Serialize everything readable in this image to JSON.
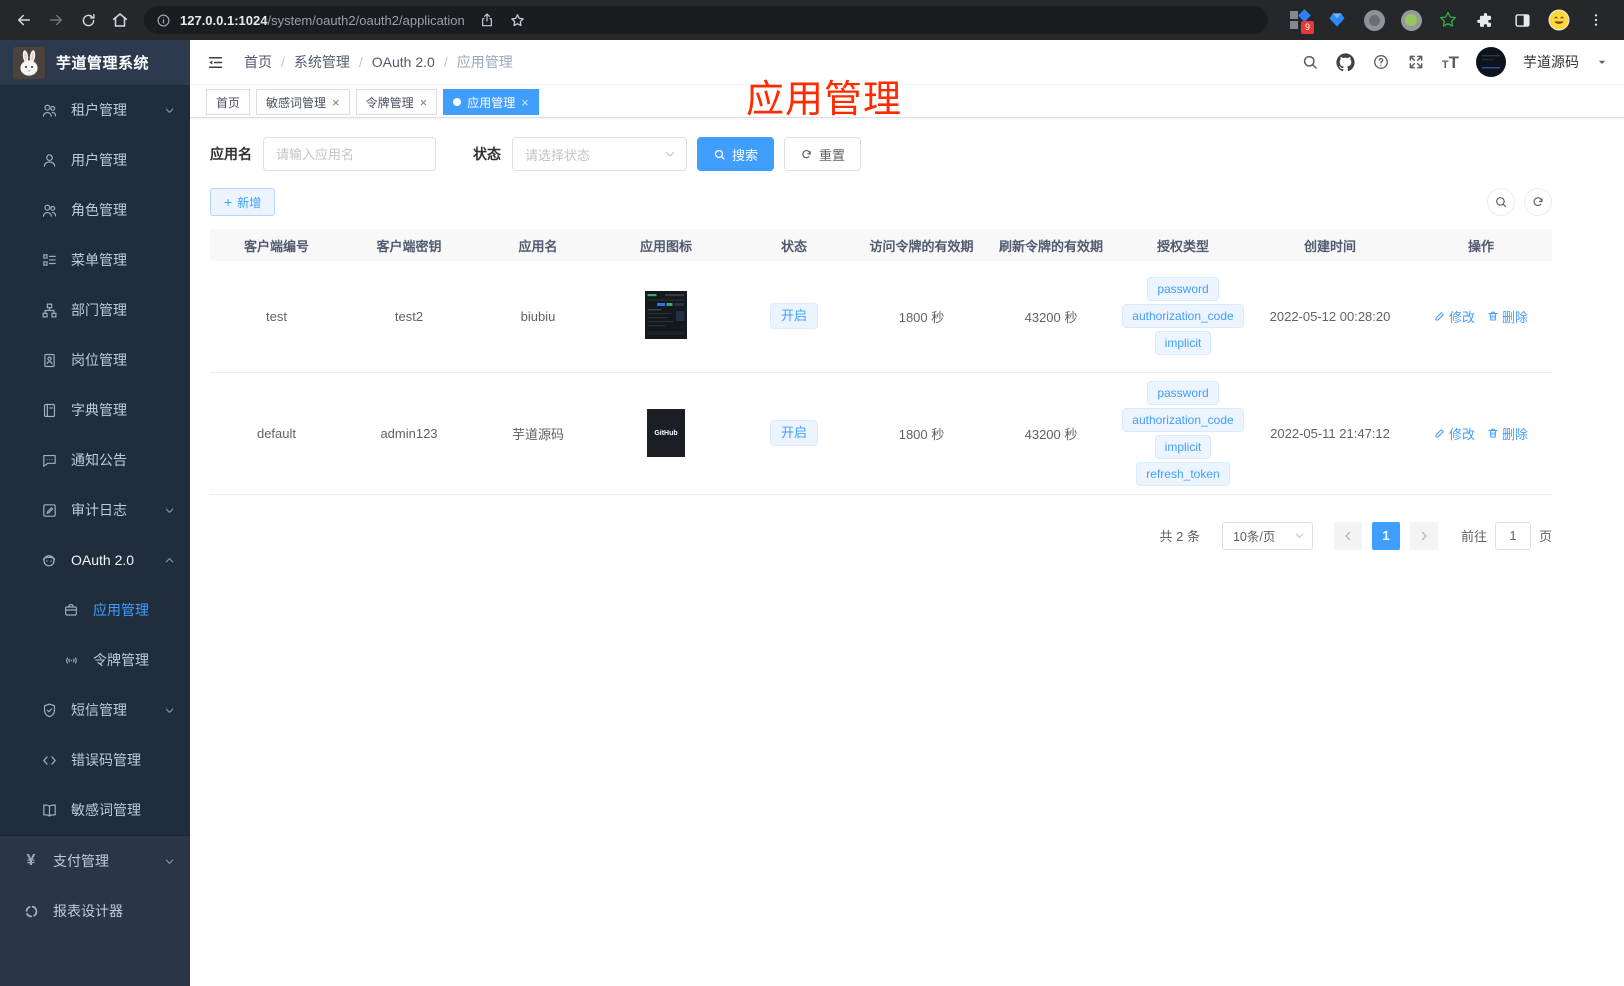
{
  "browser": {
    "host": "127.0.0.1:1024",
    "path": "/system/oauth2/oauth2/application",
    "extension_badge": "9"
  },
  "logo": {
    "title": "芋道管理系统"
  },
  "header": {
    "breadcrumb": [
      "首页",
      "系统管理",
      "OAuth 2.0",
      "应用管理"
    ],
    "sep": "/",
    "user": "芋道源码"
  },
  "tabs": [
    {
      "label": "首页"
    },
    {
      "label": "敏感词管理",
      "closable": true
    },
    {
      "label": "令牌管理",
      "closable": true
    },
    {
      "label": "应用管理",
      "closable": true,
      "active": true
    }
  ],
  "annotation": {
    "text": "应用管理",
    "color": "#ff2b00"
  },
  "sidebar": {
    "items": [
      {
        "label": "租户管理",
        "icon": "users",
        "expandable": true
      },
      {
        "label": "用户管理",
        "icon": "user"
      },
      {
        "label": "角色管理",
        "icon": "role-users"
      },
      {
        "label": "菜单管理",
        "icon": "menu-tree"
      },
      {
        "label": "部门管理",
        "icon": "org-chart"
      },
      {
        "label": "岗位管理",
        "icon": "id-badge"
      },
      {
        "label": "字典管理",
        "icon": "dictionary"
      },
      {
        "label": "通知公告",
        "icon": "announcement"
      },
      {
        "label": "审计日志",
        "icon": "audit-log",
        "expandable": true
      },
      {
        "label": "OAuth 2.0",
        "icon": "robot",
        "expandable": true,
        "expanded": true
      },
      {
        "label": "应用管理",
        "icon": "briefcase",
        "child": true,
        "active": true
      },
      {
        "label": "令牌管理",
        "icon": "token-signal",
        "child": true
      },
      {
        "label": "短信管理",
        "icon": "shield-check",
        "expandable": true
      },
      {
        "label": "错误码管理",
        "icon": "code"
      },
      {
        "label": "敏感词管理",
        "icon": "open-book"
      }
    ],
    "bottom_items": [
      {
        "label": "支付管理",
        "icon": "yen",
        "expandable": true
      },
      {
        "label": "报表设计器",
        "icon": "report-circle"
      }
    ]
  },
  "filters": {
    "name_label": "应用名",
    "name_placeholder": "请输入应用名",
    "status_label": "状态",
    "status_placeholder": "请选择状态",
    "search_label": "搜索",
    "reset_label": "重置"
  },
  "toolbar": {
    "add_label": "新增"
  },
  "icons": {
    "plus": "+",
    "close": "×",
    "yen": "¥",
    "code_glyph": "</>"
  },
  "table": {
    "columns": [
      "客户端编号",
      "客户端密钥",
      "应用名",
      "应用图标",
      "状态",
      "访问令牌的有效期",
      "刷新令牌的有效期",
      "授权类型",
      "创建时间",
      "操作"
    ],
    "edit_label": "修改",
    "delete_label": "删除",
    "rows": [
      {
        "client_id": "test",
        "secret": "test2",
        "name": "biubiu",
        "icon": "dashboard-screenshot-thumbnail",
        "status": "开启",
        "access_ttl": "1800 秒",
        "refresh_ttl": "43200 秒",
        "grants": [
          "password",
          "authorization_code",
          "implicit"
        ],
        "created": "2022-05-12 00:28:20"
      },
      {
        "client_id": "default",
        "secret": "admin123",
        "name": "芋道源码",
        "icon": "github-dark-logo",
        "icon_text": "GitHub",
        "status": "开启",
        "access_ttl": "1800 秒",
        "refresh_ttl": "43200 秒",
        "grants": [
          "password",
          "authorization_code",
          "implicit",
          "refresh_token"
        ],
        "created": "2022-05-11 21:47:12"
      }
    ]
  },
  "pagination": {
    "total": "共 2 条",
    "page_size": "10条/页",
    "current": "1",
    "goto_label": "前往",
    "goto_value": "1",
    "unit": "页"
  },
  "colors": {
    "accent": "#409eff",
    "tag_bg": "#ecf5ff",
    "tag_border": "#d9ecff",
    "sidebar_bg": "#2a3648",
    "submenu_bg": "#1f2d3d",
    "annotation": "#ff2b00"
  }
}
